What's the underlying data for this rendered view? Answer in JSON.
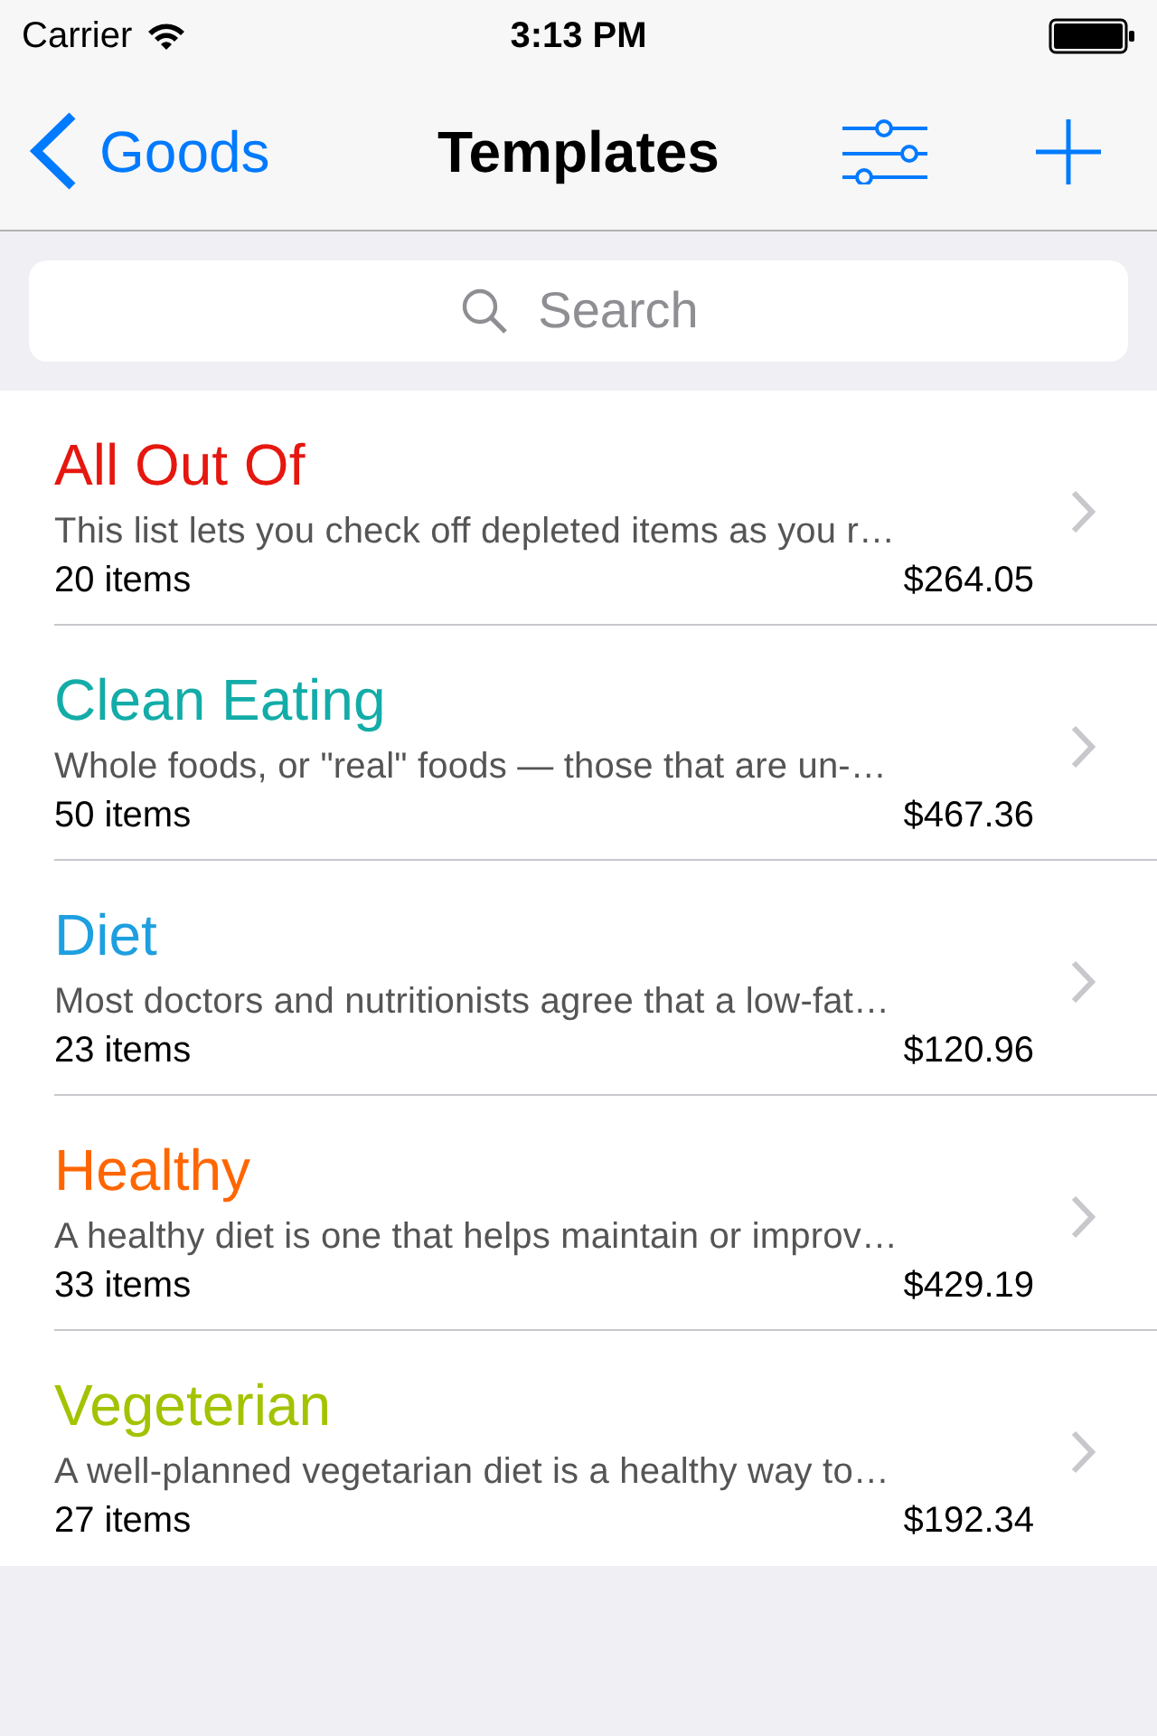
{
  "status_bar": {
    "carrier": "Carrier",
    "time": "3:13 PM"
  },
  "nav_bar": {
    "back": "Goods",
    "title": "Templates"
  },
  "search": {
    "placeholder": "Search"
  },
  "templates": [
    {
      "name": "All Out Of",
      "color": "#e5170f",
      "description": "This list lets you check off depleted items as you r…",
      "count": "20 items",
      "total": "$264.05"
    },
    {
      "name": "Clean Eating",
      "color": "#13aca8",
      "description": "Whole foods, or \"real\" foods — those that are un-…",
      "count": "50 items",
      "total": "$467.36"
    },
    {
      "name": "Diet",
      "color": "#1e9fe0",
      "description": "Most doctors and nutritionists agree that a low-fat…",
      "count": "23 items",
      "total": "$120.96"
    },
    {
      "name": "Healthy",
      "color": "#ff6600",
      "description": "A healthy diet is one that helps maintain or improv…",
      "count": "33 items",
      "total": "$429.19"
    },
    {
      "name": "Vegeterian",
      "color": "#a2c300",
      "description": "A well-planned vegetarian diet is a healthy way to…",
      "count": "27 items",
      "total": "$192.34"
    }
  ]
}
